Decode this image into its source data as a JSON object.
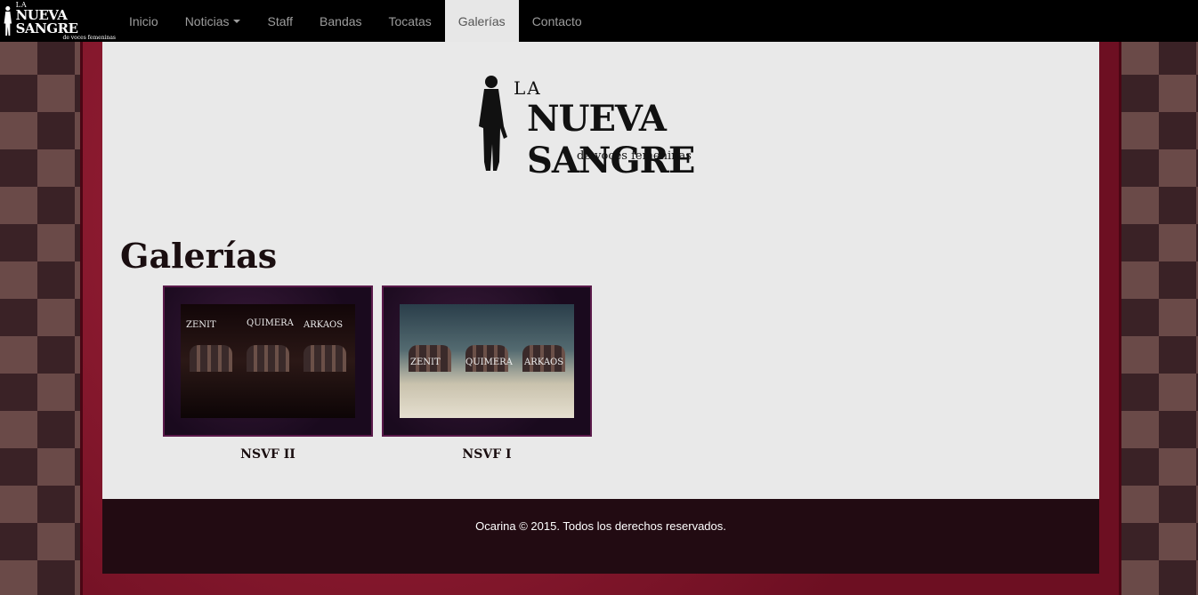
{
  "navbar": {
    "brand": {
      "line1": "LA",
      "line2": "NUEVA SANGRE",
      "line3": "de voces femeninas"
    },
    "items": [
      {
        "label": "Inicio"
      },
      {
        "label": "Noticias"
      },
      {
        "label": "Staff"
      },
      {
        "label": "Bandas"
      },
      {
        "label": "Tocatas"
      },
      {
        "label": "Galerías"
      },
      {
        "label": "Contacto"
      }
    ],
    "active": "Galerías"
  },
  "logo": {
    "line1": "LA",
    "line2": "NUEVA SANGRE",
    "line3": "de voces femeninas"
  },
  "page_title": "Galerías",
  "galleries": [
    {
      "caption": "NSVF II",
      "bands": [
        "ZENIT",
        "QUIMERA",
        "ARKAOS"
      ]
    },
    {
      "caption": "NSVF I",
      "bands": [
        "ZENIT",
        "QUIMERA",
        "ARKAOS"
      ]
    }
  ],
  "footer": {
    "text": "Ocarina © 2015. Todos los derechos reservados."
  },
  "colors": {
    "navbar": "#000000",
    "content": "#e9e9e9",
    "frame": "#8b1530",
    "footer": "#220b12"
  }
}
